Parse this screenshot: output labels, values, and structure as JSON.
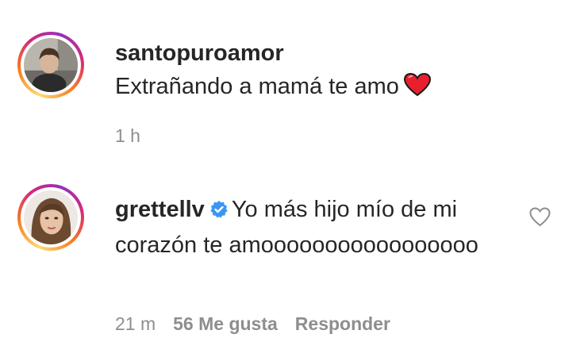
{
  "comments": [
    {
      "username": "santopuroamor",
      "text": "Extrañando a mamá te amo",
      "emoji": "heart-emoji",
      "time": "1 h"
    },
    {
      "username": "grettellv",
      "verified": true,
      "text": "Yo más hijo mío de mi corazón te amooooooooooooooooo",
      "time": "21 m",
      "likes": "56 Me gusta",
      "reply_label": "Responder",
      "like_icon": "heart-outline-icon"
    }
  ],
  "colors": {
    "text": "#262626",
    "meta": "#8e8e8e",
    "verified": "#3897f0",
    "heart": "#ed4956"
  }
}
